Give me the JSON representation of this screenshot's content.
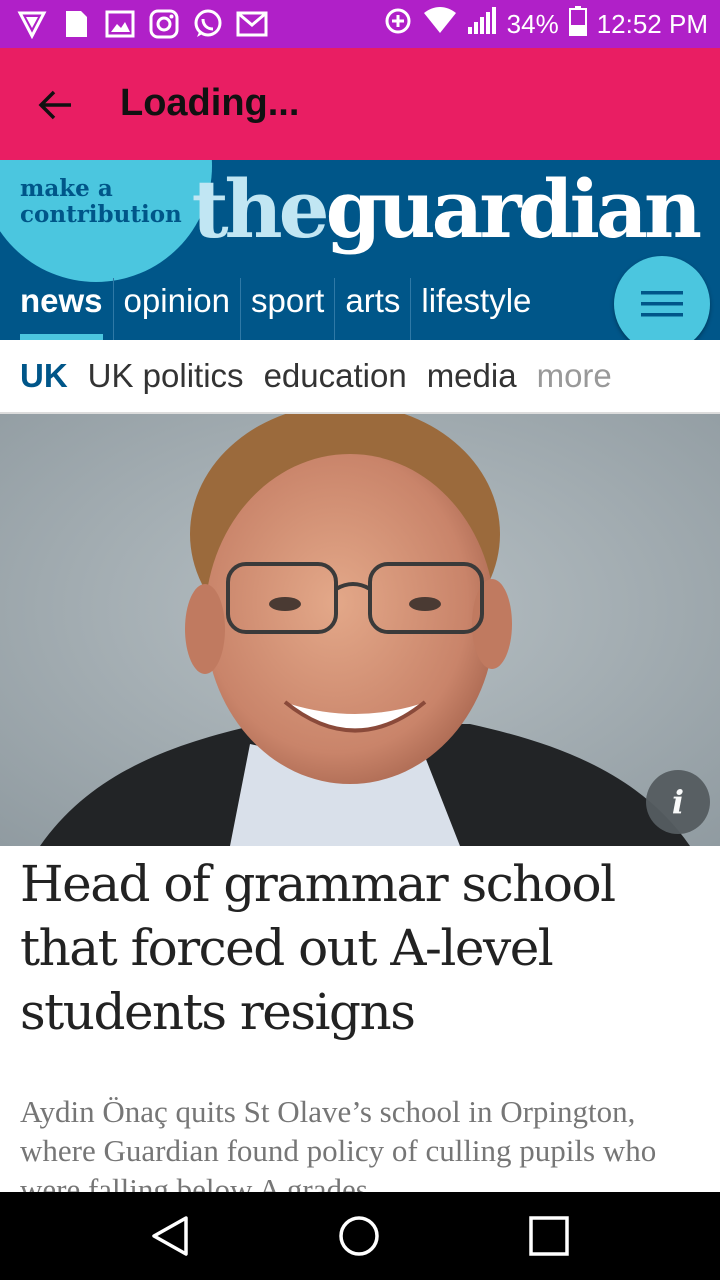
{
  "status_bar": {
    "battery": "34%",
    "time": "12:52 PM",
    "left_icons": [
      "vpn-shield-icon",
      "sim-card-icon",
      "gallery-icon",
      "instagram-icon",
      "whatsapp-icon",
      "gmail-icon"
    ],
    "right_icons": [
      "data-saver-icon",
      "wifi-icon",
      "signal-icon",
      "battery-icon"
    ]
  },
  "app_bar": {
    "title": "Loading..."
  },
  "guardian_header": {
    "contribution_text": "make a contribution",
    "logo_the": "the",
    "logo_guardian": "guardian",
    "nav_items": [
      "news",
      "opinion",
      "sport",
      "arts",
      "lifestyle"
    ],
    "active_nav": "news"
  },
  "subnav": {
    "items": [
      "UK",
      "UK politics",
      "education",
      "media",
      "more"
    ]
  },
  "article": {
    "photo_info_label": "i",
    "headline": "Head of grammar school that forced out A-level students resigns",
    "standfirst": "Aydin Önaç quits St Olave’s school in Orpington, where Guardian found policy of culling pupils who were falling below A grades"
  },
  "colors": {
    "status_bar": "#b020c8",
    "app_bar": "#e91e63",
    "guardian_blue": "#005689",
    "guardian_cyan": "#4bc6df"
  }
}
